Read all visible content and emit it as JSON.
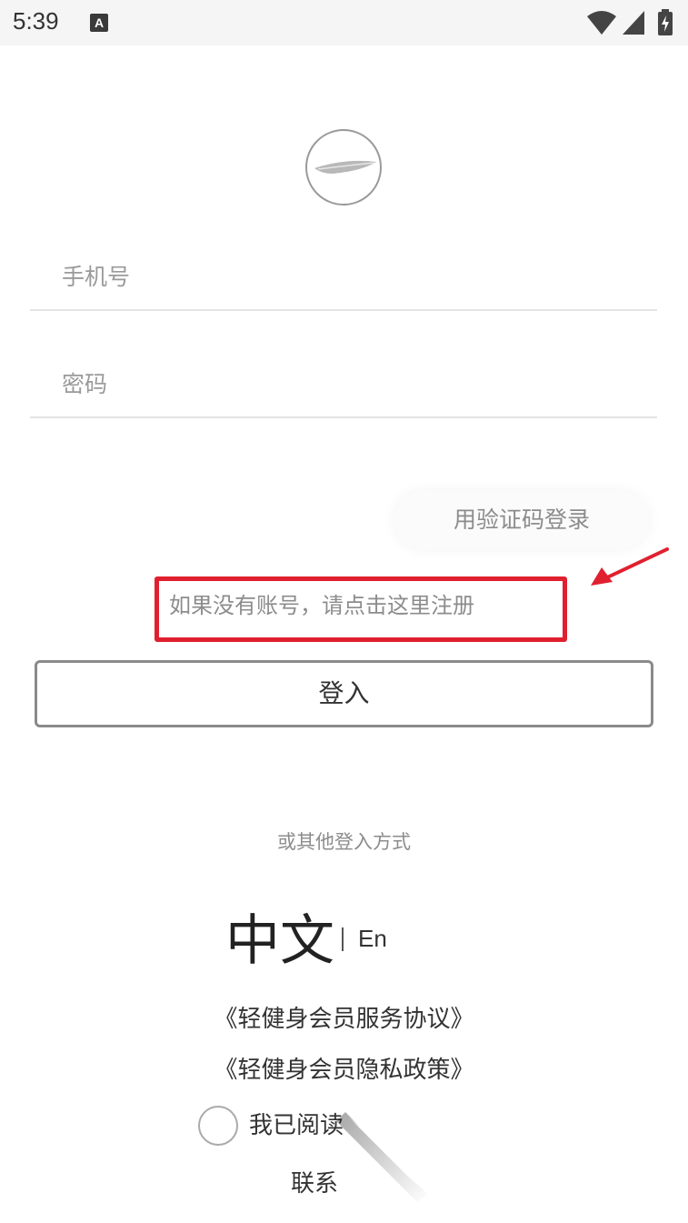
{
  "status_bar": {
    "time": "5:39",
    "keyboard_badge": "A",
    "icons": [
      "wifi-icon",
      "signal-icon",
      "battery-charging-icon"
    ]
  },
  "logo": {
    "icon": "feather-icon"
  },
  "form": {
    "phone_placeholder": "手机号",
    "password_placeholder": "密码"
  },
  "code_login_label": "用验证码登录",
  "register_link": "如果没有账号，请点击这里注册",
  "login_button": "登入",
  "other_login_label": "或其他登入方式",
  "language": {
    "zh": "中文",
    "en": "En"
  },
  "agreements": {
    "service": "《轻健身会员服务协议》",
    "privacy": "《轻健身会员隐私政策》"
  },
  "consent_text": "我已阅读",
  "contact_text": "联系",
  "colors": {
    "highlight_box": "#e0202f",
    "annotation_arrow": "#e0202f",
    "placeholder_text": "#9a9a9a"
  }
}
